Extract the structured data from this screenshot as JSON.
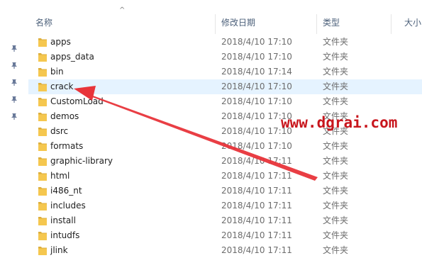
{
  "columns": {
    "name": "名称",
    "date": "修改日期",
    "type": "类型",
    "size": "大小"
  },
  "sort_indicator": "^",
  "files": [
    {
      "name": "apps",
      "date": "2018/4/10 17:10",
      "type": "文件夹"
    },
    {
      "name": "apps_data",
      "date": "2018/4/10 17:10",
      "type": "文件夹"
    },
    {
      "name": "bin",
      "date": "2018/4/10 17:14",
      "type": "文件夹"
    },
    {
      "name": "crack",
      "date": "2018/4/10 17:10",
      "type": "文件夹",
      "selected": true
    },
    {
      "name": "CustomLoad",
      "date": "2018/4/10 17:10",
      "type": "文件夹"
    },
    {
      "name": "demos",
      "date": "2018/4/10 17:10",
      "type": "文件夹"
    },
    {
      "name": "dsrc",
      "date": "2018/4/10 17:10",
      "type": "文件夹"
    },
    {
      "name": "formats",
      "date": "2018/4/10 17:10",
      "type": "文件夹"
    },
    {
      "name": "graphic-library",
      "date": "2018/4/10 17:11",
      "type": "文件夹"
    },
    {
      "name": "html",
      "date": "2018/4/10 17:11",
      "type": "文件夹"
    },
    {
      "name": "i486_nt",
      "date": "2018/4/10 17:11",
      "type": "文件夹"
    },
    {
      "name": "includes",
      "date": "2018/4/10 17:11",
      "type": "文件夹"
    },
    {
      "name": "install",
      "date": "2018/4/10 17:11",
      "type": "文件夹"
    },
    {
      "name": "intudfs",
      "date": "2018/4/10 17:11",
      "type": "文件夹"
    },
    {
      "name": "jlink",
      "date": "2018/4/10 17:11",
      "type": "文件夹"
    }
  ],
  "watermark": "www.dgrai.com",
  "colors": {
    "folder": "#f5c74f",
    "selection": "#e5f3ff",
    "header_text": "#4c607a",
    "annotation_red": "#e8343a",
    "watermark_red": "#c8161d"
  },
  "icons": {
    "folder": "folder-icon",
    "pin": "pin-icon"
  }
}
